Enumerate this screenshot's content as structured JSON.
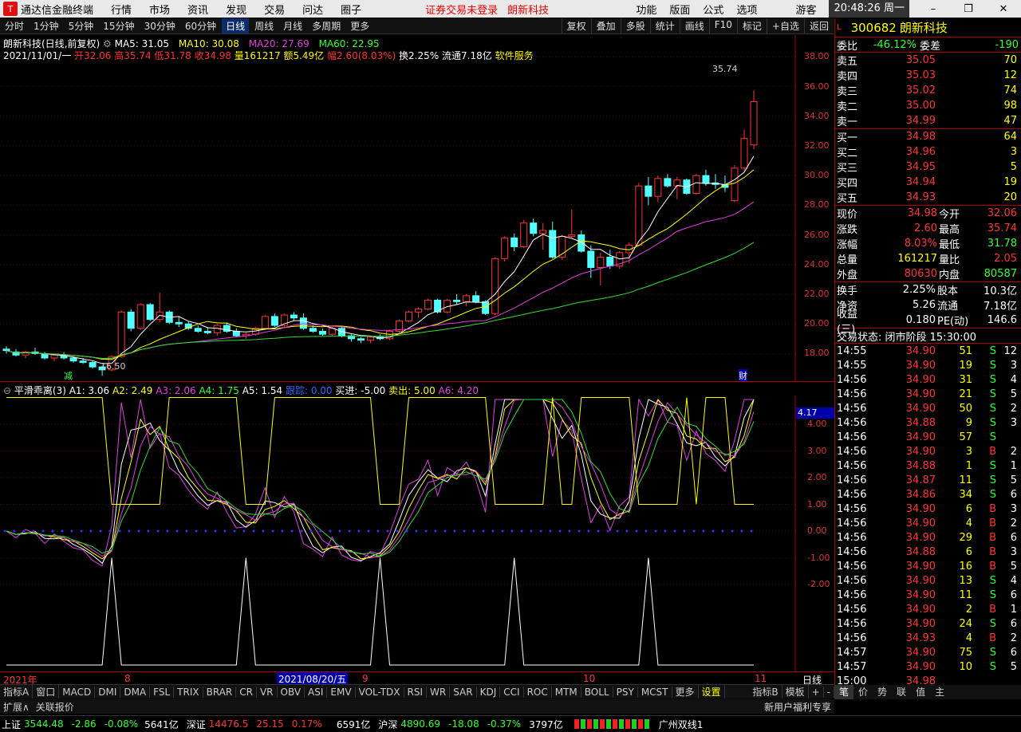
{
  "titlebar": {
    "app": "通达信金融终端",
    "menus": [
      "行情",
      "市场",
      "资讯",
      "发现",
      "交易",
      "问达",
      "圈子"
    ],
    "notice": "证券交易未登录",
    "stock": "朗新科技",
    "right_menus": [
      "功能",
      "版面",
      "公式",
      "选项"
    ],
    "user": "游客",
    "clock": "20:48:26 周一"
  },
  "toolbar": {
    "periods": [
      "分时",
      "1分钟",
      "5分钟",
      "15分钟",
      "30分钟",
      "60分钟",
      "日线",
      "周线",
      "月线",
      "多周期",
      "更多"
    ],
    "active": "日线",
    "right": [
      "复权",
      "叠加",
      "多股",
      "统计",
      "画线",
      "F10",
      "标记",
      "+自选",
      "返回"
    ]
  },
  "main_info": {
    "line1_name": "朗新科技(日线,前复权)",
    "ma5": "MA5: 31.05",
    "ma10": "MA10: 30.08",
    "ma20": "MA20: 27.69",
    "ma60": "MA60: 22.95",
    "line2_date": "2021/11/01/一",
    "open": "开32.06",
    "high": "高35.74",
    "low": "低31.78",
    "close": "收34.98",
    "vol": "量161217",
    "amt": "额5.49亿",
    "chg": "幅2.60(8.03%)",
    "turn": "换2.25%",
    "float": "流通7.18亿",
    "industry": "软件服务",
    "max_label": "35.74",
    "min_label": "16.50",
    "tag_jian": "减",
    "tag_cai": "财"
  },
  "price_axis": [
    "38.00",
    "36.00",
    "34.00",
    "32.00",
    "30.00",
    "28.00",
    "26.00",
    "24.00",
    "22.00",
    "20.00",
    "18.00"
  ],
  "ind_info": {
    "name": "平滑乖离(3)",
    "a1": "A1: 3.06",
    "a2": "A2: 2.49",
    "a3": "A3: 2.06",
    "a4": "A4: 1.75",
    "a5": "A5: 1.54",
    "mid": "跟踪: 0.00",
    "buy": "买进: -5.00",
    "sell": "卖出: 5.00",
    "a6": "A6: 4.20",
    "current": "4.17"
  },
  "ind_axis": [
    "4.00",
    "3.00",
    "2.00",
    "1.00",
    "0.00",
    "-1.00",
    "-2.00"
  ],
  "date_axis": {
    "y2021": "2021年",
    "m8": "8",
    "sel": "2021/08/20/五",
    "m9": "9",
    "m10": "10",
    "m11": "11",
    "right": "日线"
  },
  "indicators": [
    "指标A",
    "窗口",
    "MACD",
    "DMI",
    "DMA",
    "FSL",
    "TRIX",
    "BRAR",
    "CR",
    "VR",
    "OBV",
    "ASI",
    "EMV",
    "VOL-TDX",
    "RSI",
    "WR",
    "SAR",
    "KDJ",
    "CCI",
    "ROC",
    "MTM",
    "BOLL",
    "PSY",
    "MCST",
    "更多",
    "设置"
  ],
  "indicators_right": [
    "指标B",
    "模板",
    "+",
    "-"
  ],
  "status_left": [
    "扩展∧",
    "关联报价"
  ],
  "status_right": "新用户福利专享",
  "ticker": {
    "sh_name": "上证",
    "sh_val": "3544.48",
    "sh_chg": "-2.86",
    "sh_pct": "-0.08%",
    "sh_amt": "5641亿",
    "sz_name": "深证",
    "sz_val": "14476.5",
    "sz_chg": "25.15",
    "sz_pct": "0.17%",
    "sz_amt": "6591亿",
    "hs_name": "沪深",
    "hs_val": "4890.69",
    "hs_chg": "-18.08",
    "hs_pct": "-0.37%",
    "hs_amt": "3797亿",
    "news": "广州双线1"
  },
  "quote": {
    "code": "300682",
    "name": "朗新科技",
    "code_prefix": "L",
    "wb_label": "委比",
    "wb": "-46.12%",
    "wc_label": "委差",
    "wc": "-190",
    "sells": [
      {
        "l": "卖五",
        "p": "35.05",
        "v": "70"
      },
      {
        "l": "卖四",
        "p": "35.03",
        "v": "12"
      },
      {
        "l": "卖三",
        "p": "35.02",
        "v": "74"
      },
      {
        "l": "卖二",
        "p": "35.00",
        "v": "98"
      },
      {
        "l": "卖一",
        "p": "34.99",
        "v": "47"
      }
    ],
    "buys": [
      {
        "l": "买一",
        "p": "34.98",
        "v": "64"
      },
      {
        "l": "买二",
        "p": "34.96",
        "v": "3"
      },
      {
        "l": "买三",
        "p": "34.95",
        "v": "5"
      },
      {
        "l": "买四",
        "p": "34.94",
        "v": "19"
      },
      {
        "l": "买五",
        "p": "34.93",
        "v": "20"
      }
    ],
    "stats": [
      {
        "l1": "现价",
        "v1": "34.98",
        "c1": "up",
        "l2": "今开",
        "v2": "32.06",
        "c2": "up"
      },
      {
        "l1": "涨跌",
        "v1": "2.60",
        "c1": "up",
        "l2": "最高",
        "v2": "35.74",
        "c2": "up"
      },
      {
        "l1": "涨幅",
        "v1": "8.03%",
        "c1": "up",
        "l2": "最低",
        "v2": "31.78",
        "c2": "dn"
      },
      {
        "l1": "总量",
        "v1": "161217",
        "c1": "y",
        "l2": "量比",
        "v2": "2.05",
        "c2": "up"
      },
      {
        "l1": "外盘",
        "v1": "80630",
        "c1": "up",
        "l2": "内盘",
        "v2": "80587",
        "c2": "dn"
      }
    ],
    "stats2": [
      {
        "l1": "换手",
        "v1": "2.25%",
        "l2": "股本",
        "v2": "10.3亿"
      },
      {
        "l1": "净资",
        "v1": "5.26",
        "l2": "流通",
        "v2": "7.18亿"
      },
      {
        "l1": "收益(三)",
        "v1": "0.180",
        "l2": "PE(动)",
        "v2": "146.6"
      }
    ],
    "state": "交易状态: 闭市阶段 15:30:00",
    "ticks": [
      [
        "14:55",
        "34.90",
        "51",
        "S",
        "12"
      ],
      [
        "14:55",
        "34.90",
        "19",
        "S",
        "3"
      ],
      [
        "14:56",
        "34.90",
        "31",
        "S",
        "4"
      ],
      [
        "14:56",
        "34.90",
        "21",
        "S",
        "5"
      ],
      [
        "14:56",
        "34.90",
        "50",
        "S",
        "2"
      ],
      [
        "14:56",
        "34.88",
        "9",
        "S",
        "3"
      ],
      [
        "14:56",
        "34.90",
        "57",
        "S",
        ""
      ],
      [
        "14:56",
        "34.90",
        "3",
        "B",
        "2"
      ],
      [
        "14:56",
        "34.88",
        "1",
        "S",
        "1"
      ],
      [
        "14:56",
        "34.87",
        "11",
        "S",
        "5"
      ],
      [
        "14:56",
        "34.86",
        "34",
        "S",
        "6"
      ],
      [
        "14:56",
        "34.90",
        "6",
        "B",
        "3"
      ],
      [
        "14:56",
        "34.90",
        "4",
        "B",
        "2"
      ],
      [
        "14:56",
        "34.90",
        "29",
        "B",
        "6"
      ],
      [
        "14:56",
        "34.88",
        "6",
        "B",
        "3"
      ],
      [
        "14:56",
        "34.90",
        "16",
        "B",
        "5"
      ],
      [
        "14:56",
        "34.90",
        "13",
        "S",
        "4"
      ],
      [
        "14:56",
        "34.90",
        "11",
        "S",
        "6"
      ],
      [
        "14:56",
        "34.90",
        "2",
        "B",
        "1"
      ],
      [
        "14:56",
        "34.90",
        "24",
        "S",
        "6"
      ],
      [
        "14:56",
        "34.93",
        "4",
        "B",
        "2"
      ],
      [
        "14:57",
        "34.90",
        "75",
        "S",
        "6"
      ],
      [
        "14:57",
        "34.90",
        "10",
        "S",
        "5"
      ],
      [
        "15:00",
        "34.98",
        "",
        "",
        ""
      ]
    ],
    "tabs": [
      "笔",
      "价",
      "势",
      "联",
      "值",
      "主"
    ]
  },
  "chart_data": {
    "type": "candlestick",
    "title": "朗新科技(日线,前复权)",
    "ylim": [
      17,
      38.5
    ],
    "candles": [
      [
        18.3,
        18.5,
        18.0,
        18.2
      ],
      [
        18.1,
        18.3,
        17.8,
        17.9
      ],
      [
        17.9,
        18.2,
        17.7,
        18.1
      ],
      [
        18.1,
        18.4,
        17.9,
        18.0
      ],
      [
        18.0,
        18.1,
        17.6,
        17.7
      ],
      [
        17.7,
        18.0,
        17.5,
        17.9
      ],
      [
        17.9,
        18.1,
        17.6,
        17.7
      ],
      [
        17.7,
        17.8,
        17.4,
        17.5
      ],
      [
        17.5,
        17.7,
        17.3,
        17.4
      ],
      [
        17.4,
        17.5,
        17.0,
        17.1
      ],
      [
        17.1,
        17.2,
        16.5,
        16.9
      ],
      [
        16.9,
        17.9,
        16.8,
        17.8
      ],
      [
        17.8,
        20.9,
        17.7,
        20.8
      ],
      [
        20.8,
        21.0,
        19.5,
        19.7
      ],
      [
        19.7,
        21.4,
        19.6,
        21.3
      ],
      [
        21.3,
        21.4,
        20.2,
        20.3
      ],
      [
        20.3,
        22.1,
        20.1,
        20.8
      ],
      [
        20.8,
        20.9,
        20.0,
        20.1
      ],
      [
        20.1,
        20.5,
        19.8,
        20.0
      ],
      [
        20.0,
        20.2,
        19.6,
        19.7
      ],
      [
        19.7,
        19.9,
        19.4,
        19.5
      ],
      [
        19.5,
        19.8,
        19.3,
        19.4
      ],
      [
        19.4,
        20.0,
        19.2,
        19.9
      ],
      [
        19.9,
        20.1,
        19.4,
        19.5
      ],
      [
        19.5,
        19.7,
        19.1,
        19.2
      ],
      [
        19.2,
        19.4,
        19.0,
        19.3
      ],
      [
        19.3,
        19.8,
        19.2,
        19.7
      ],
      [
        19.7,
        20.6,
        19.6,
        20.5
      ],
      [
        20.5,
        20.7,
        19.8,
        19.9
      ],
      [
        19.9,
        20.7,
        19.8,
        20.6
      ],
      [
        20.6,
        20.8,
        20.2,
        20.4
      ],
      [
        20.4,
        20.7,
        19.6,
        19.7
      ],
      [
        19.7,
        19.9,
        19.4,
        19.5
      ],
      [
        19.5,
        19.7,
        19.2,
        19.3
      ],
      [
        19.3,
        19.8,
        19.2,
        19.7
      ],
      [
        19.7,
        19.8,
        19.1,
        19.2
      ],
      [
        19.2,
        19.3,
        18.8,
        19.0
      ],
      [
        19.0,
        19.1,
        18.7,
        18.9
      ],
      [
        18.9,
        19.2,
        18.7,
        19.1
      ],
      [
        19.1,
        19.3,
        18.9,
        19.0
      ],
      [
        19.0,
        19.6,
        18.9,
        19.5
      ],
      [
        19.5,
        20.3,
        19.4,
        20.2
      ],
      [
        20.2,
        20.9,
        20.1,
        20.8
      ],
      [
        20.8,
        21.1,
        20.4,
        21.0
      ],
      [
        21.0,
        21.7,
        20.9,
        21.6
      ],
      [
        21.6,
        21.7,
        20.7,
        20.8
      ],
      [
        20.8,
        21.7,
        20.7,
        21.6
      ],
      [
        21.6,
        22.0,
        21.3,
        21.5
      ],
      [
        21.5,
        22.0,
        21.2,
        21.9
      ],
      [
        21.9,
        22.2,
        21.4,
        21.5
      ],
      [
        21.5,
        21.6,
        20.6,
        20.7
      ],
      [
        20.7,
        24.5,
        20.6,
        24.4
      ],
      [
        24.4,
        25.9,
        24.2,
        25.8
      ],
      [
        25.8,
        26.1,
        24.9,
        25.2
      ],
      [
        25.2,
        27.0,
        25.1,
        26.8
      ],
      [
        26.8,
        27.1,
        25.9,
        26.1
      ],
      [
        26.1,
        26.8,
        25.0,
        26.3
      ],
      [
        26.3,
        26.9,
        24.4,
        24.5
      ],
      [
        24.5,
        26.0,
        24.3,
        25.9
      ],
      [
        25.9,
        27.7,
        25.8,
        26.0
      ],
      [
        26.0,
        26.3,
        24.8,
        24.9
      ],
      [
        24.9,
        25.3,
        23.1,
        23.8
      ],
      [
        23.8,
        24.8,
        22.6,
        24.5
      ],
      [
        24.5,
        25.0,
        23.7,
        23.9
      ],
      [
        23.9,
        24.9,
        23.7,
        24.8
      ],
      [
        24.8,
        25.5,
        24.1,
        25.3
      ],
      [
        25.3,
        29.5,
        25.2,
        29.3
      ],
      [
        29.3,
        29.9,
        28.0,
        28.6
      ],
      [
        28.6,
        30.0,
        28.2,
        29.8
      ],
      [
        29.8,
        30.1,
        29.2,
        29.3
      ],
      [
        29.3,
        29.9,
        28.4,
        29.7
      ],
      [
        29.7,
        29.8,
        28.7,
        28.8
      ],
      [
        28.8,
        30.1,
        28.7,
        30.0
      ],
      [
        30.0,
        30.4,
        29.3,
        29.5
      ],
      [
        29.5,
        30.1,
        29.1,
        29.4
      ],
      [
        29.4,
        30.0,
        28.9,
        29.2
      ],
      [
        28.3,
        30.7,
        28.2,
        30.5
      ],
      [
        30.5,
        33.1,
        30.3,
        32.5
      ],
      [
        32.06,
        35.74,
        31.78,
        34.98
      ]
    ]
  }
}
